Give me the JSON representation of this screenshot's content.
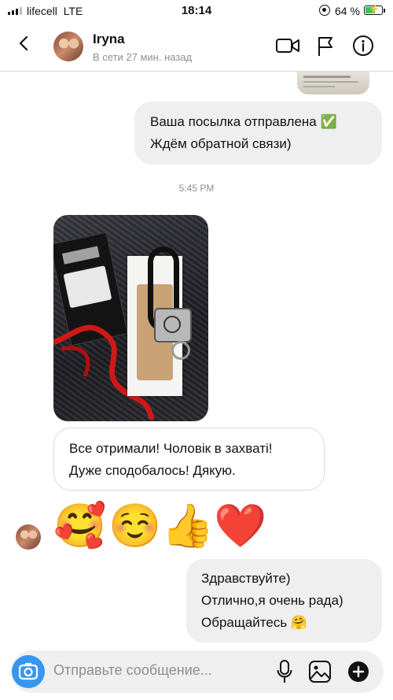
{
  "status_bar": {
    "carrier": "lifecell",
    "network": "LTE",
    "time": "18:14",
    "battery_text": "64 %",
    "battery_level": 0.64
  },
  "header": {
    "name": "Iryna",
    "presence": "В сети 27 мин. назад"
  },
  "messages": {
    "out1": {
      "line1": "Ваша посылка отправлена ✅",
      "line2": "Ждём обратной связи)"
    },
    "timestamp": "5:45 PM",
    "in1": {
      "line1": "Все отримали! Чоловік в захваті!",
      "line2": "Дуже сподобалось! Дякую."
    },
    "emojis": [
      "🥰",
      "☺️",
      "👍",
      "❤️"
    ],
    "out2": {
      "line1": "Здравствуйте)",
      "line2": "Отлично,я очень рада)",
      "line3": "Обращайтесь 🤗"
    }
  },
  "composer": {
    "placeholder": "Отправьте сообщение..."
  },
  "colors": {
    "accent": "#3797f0",
    "battery": "#34c759",
    "heart": "#ed1c24"
  },
  "icons": [
    "back-chevron-icon",
    "video-call-icon",
    "flag-icon",
    "info-icon",
    "camera-icon",
    "microphone-icon",
    "gallery-icon",
    "plus-icon"
  ]
}
